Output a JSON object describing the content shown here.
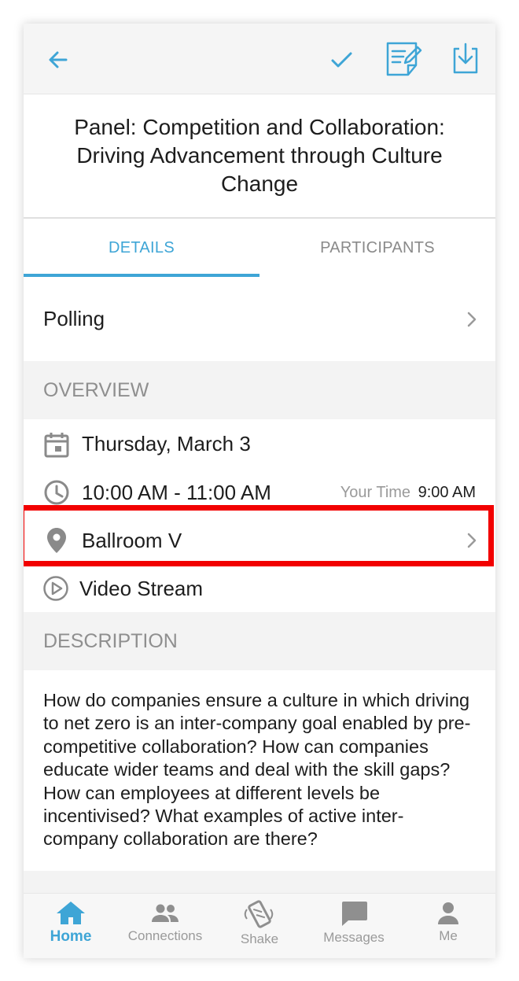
{
  "header": {
    "title": "Panel: Competition and Collaboration: Driving Advancement through Culture Change"
  },
  "tabs": [
    {
      "label": "DETAILS",
      "active": true
    },
    {
      "label": "PARTICIPANTS",
      "active": false
    }
  ],
  "polling": {
    "label": "Polling"
  },
  "overview": {
    "header": "OVERVIEW",
    "date": "Thursday, March 3",
    "time": "10:00 AM - 11:00 AM",
    "your_time_label": "Your Time",
    "your_time_value": "9:00 AM",
    "location": "Ballroom V",
    "video": "Video Stream"
  },
  "description": {
    "header": "DESCRIPTION",
    "text": "How do companies ensure a culture in which driving to net zero is an inter-company goal enabled by pre-competitive collaboration? How can companies educate wider teams and deal with the skill gaps? How can employees at different levels be incentivised? What examples of active inter-company collaboration are there?"
  },
  "nav": [
    {
      "label": "Home",
      "icon": "home-icon",
      "active": true
    },
    {
      "label": "Connections",
      "icon": "people-icon",
      "active": false
    },
    {
      "label": "Shake",
      "icon": "shake-phone-icon",
      "active": false
    },
    {
      "label": "Messages",
      "icon": "chat-icon",
      "active": false
    },
    {
      "label": "Me",
      "icon": "person-icon",
      "active": false
    }
  ],
  "colors": {
    "accent": "#3ea5d6",
    "highlight": "#f20000",
    "muted": "#8f8f8f"
  }
}
